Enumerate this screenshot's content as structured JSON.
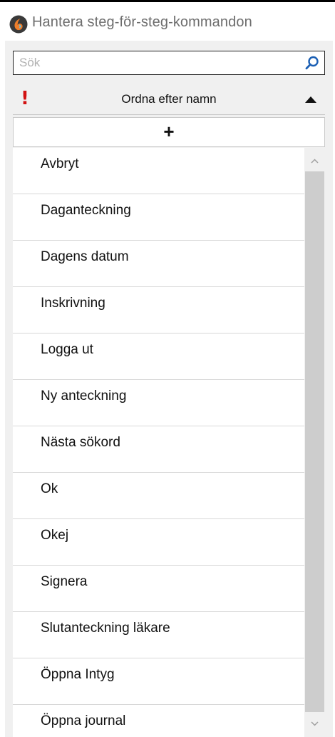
{
  "window": {
    "title": "Hantera steg-för-steg-kommandon",
    "icon": "app-logo-icon"
  },
  "search": {
    "placeholder": "Sök",
    "value": "",
    "icon": "search-icon"
  },
  "sort": {
    "priority_marker": "!",
    "label": "Ordna efter namn",
    "direction": "ascending",
    "icon": "sort-ascending-icon"
  },
  "add": {
    "label": "+"
  },
  "commands": [
    "Avbryt",
    "Daganteckning",
    "Dagens datum",
    "Inskrivning",
    "Logga ut",
    "Ny anteckning",
    "Nästa sökord",
    "Ok",
    "Okej",
    "Signera",
    "Slutanteckning läkare",
    "Öppna Intyg",
    "Öppna journal"
  ],
  "colors": {
    "priority_marker": "#d21111",
    "app_icon": "#3a3a3a",
    "app_icon_accent": "#f07f2b"
  }
}
